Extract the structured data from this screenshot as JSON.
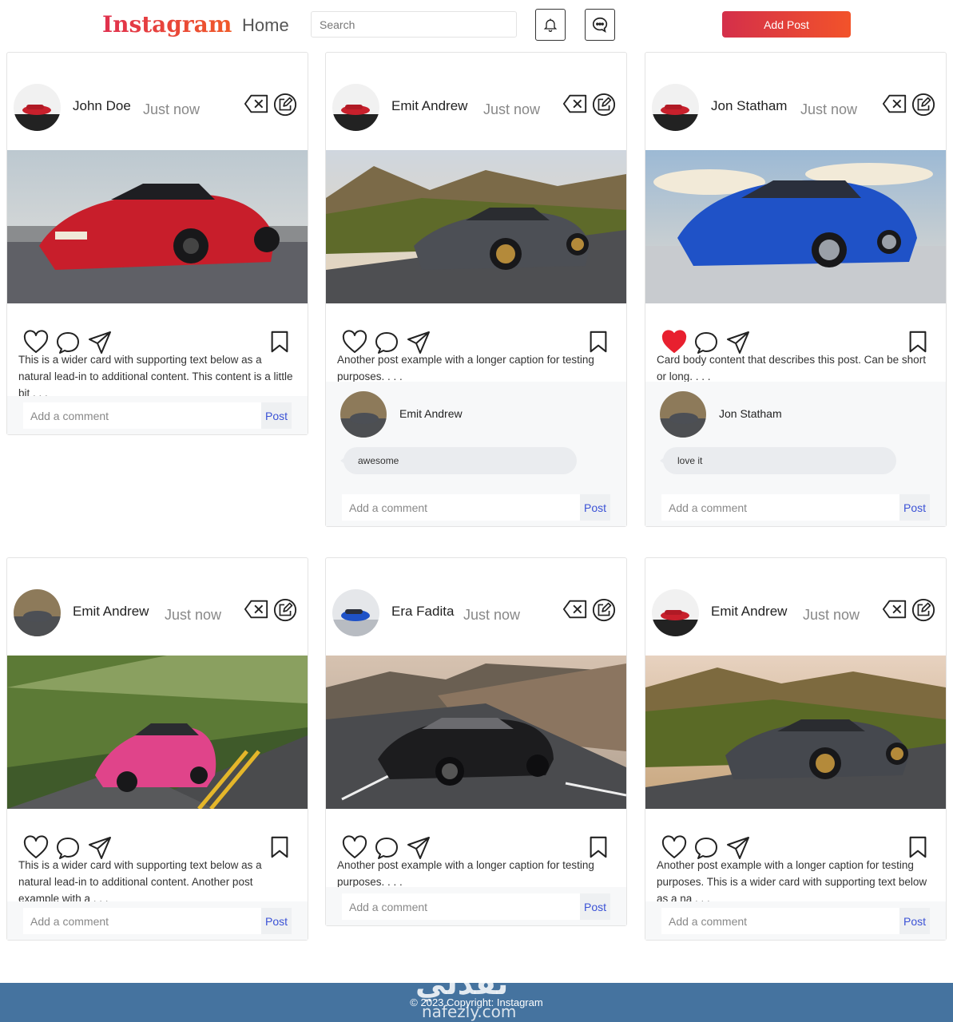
{
  "navbar": {
    "logo": "Instagram",
    "home_label": "Home",
    "search_placeholder": "Search",
    "add_post_label": "Add Post",
    "icons": [
      "bell-icon",
      "chat-icon"
    ]
  },
  "posts": [
    {
      "author": "John Doe",
      "time": "Just now",
      "caption": "This is a wider card with supporting text below as a natural lead-in to additional content. This content is a little bit . . .",
      "image": "red porsche convertible on road",
      "liked": false,
      "comment_placeholder": "Add a comment",
      "post_label": "Post"
    },
    {
      "author": "Emit Andrew",
      "time": "Just now",
      "caption": "Another post example with a longer caption for testing purposes. . . .",
      "image": "grey porsche on mountain road",
      "liked": false,
      "comment": {
        "author": "Emit Andrew",
        "text": "awesome"
      },
      "comment_placeholder": "Add a comment",
      "post_label": "Post"
    },
    {
      "author": "Jon Statham",
      "time": "Just now",
      "caption": "Card body content that describes this post. Can be short or long. . . .",
      "image": "blue porsche 911",
      "liked": true,
      "comment": {
        "author": "Jon Statham",
        "text": "love it"
      },
      "comment_placeholder": "Add a comment",
      "post_label": "Post"
    },
    {
      "author": "Emit Andrew",
      "time": "Just now",
      "caption": "This is a wider card with supporting text below as a natural lead-in to additional content. Another post example with a . . .",
      "image": "pink porsche on forest road",
      "liked": false,
      "comment_placeholder": "Add a comment",
      "post_label": "Post"
    },
    {
      "author": "Era Fadita",
      "time": "Just now",
      "caption": "Another post example with a longer caption for testing purposes. . . .",
      "image": "black porsche convertible on hill road",
      "liked": false,
      "comment_placeholder": "Add a comment",
      "post_label": "Post"
    },
    {
      "author": "Emit Andrew",
      "time": "Just now",
      "caption": "Another post example with a longer caption for testing purposes. This is a wider card with supporting text below as a na . . .",
      "image": "grey porsche at sunset",
      "liked": false,
      "comment_placeholder": "Add a comment",
      "post_label": "Post"
    }
  ],
  "footer": {
    "copyright": "© 2023 Copyright: Instagram",
    "watermark_ar": "نفذلي",
    "watermark_en": "nafezly.com"
  },
  "colors": {
    "brand_gradient_start": "#d42f4a",
    "brand_gradient_end": "#f2532a",
    "like_red": "#e8202f",
    "post_link": "#3b52d6",
    "footer_bg": "#45739f"
  }
}
